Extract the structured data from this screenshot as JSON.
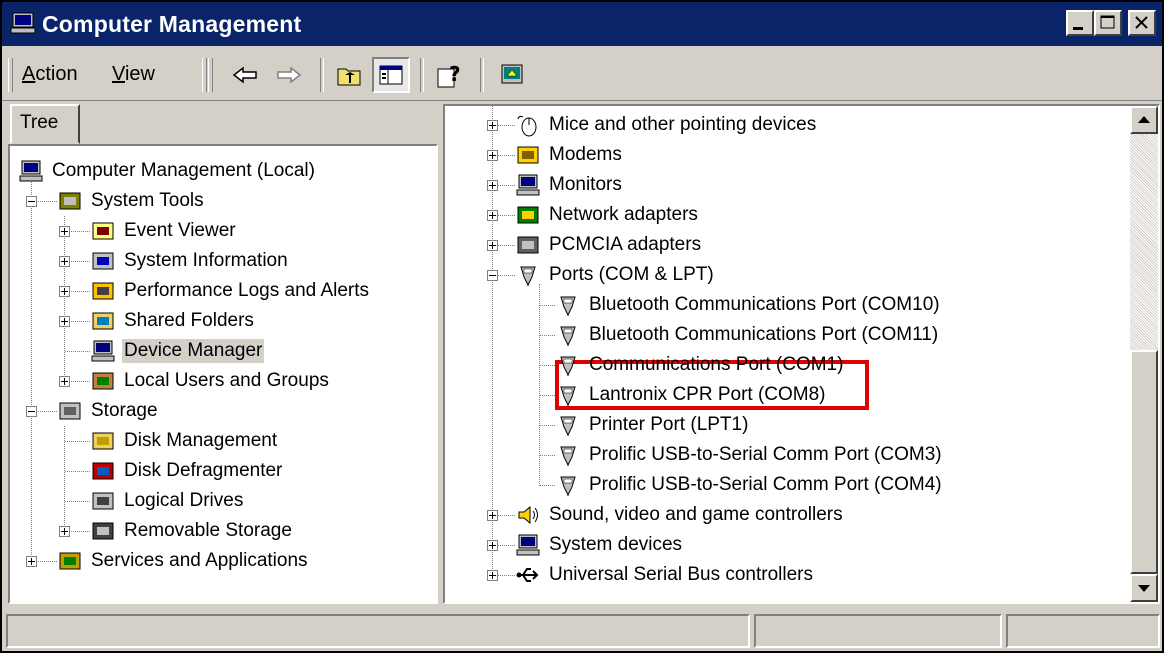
{
  "window": {
    "title": "Computer Management",
    "icon": "computer-management-icon",
    "controls": [
      "minimize",
      "maximize",
      "close"
    ]
  },
  "menubar": {
    "items": [
      {
        "label": "Action",
        "accel": "A"
      },
      {
        "label": "View",
        "accel": "V"
      }
    ],
    "toolbar": [
      "back-arrow-icon",
      "forward-arrow-icon",
      "up-one-level-icon",
      "show-hide-tree-icon",
      "help-icon",
      "device-properties-icon"
    ]
  },
  "left_pane": {
    "tab_label": "Tree",
    "tree": [
      {
        "label": "Computer Management (Local)",
        "icon": "computer-icon",
        "level": 0,
        "expander": "none"
      },
      {
        "label": "System Tools",
        "icon": "system-tools-icon",
        "level": 1,
        "expander": "minus"
      },
      {
        "label": "Event Viewer",
        "icon": "event-viewer-icon",
        "level": 2,
        "expander": "plus"
      },
      {
        "label": "System Information",
        "icon": "system-information-icon",
        "level": 2,
        "expander": "plus"
      },
      {
        "label": "Performance Logs and Alerts",
        "icon": "performance-logs-icon",
        "level": 2,
        "expander": "plus"
      },
      {
        "label": "Shared Folders",
        "icon": "shared-folders-icon",
        "level": 2,
        "expander": "plus"
      },
      {
        "label": "Device Manager",
        "icon": "device-manager-icon",
        "level": 2,
        "expander": "none",
        "selected": true
      },
      {
        "label": "Local Users and Groups",
        "icon": "local-users-icon",
        "level": 2,
        "expander": "plus"
      },
      {
        "label": "Storage",
        "icon": "storage-icon",
        "level": 1,
        "expander": "minus"
      },
      {
        "label": "Disk Management",
        "icon": "disk-management-icon",
        "level": 2,
        "expander": "none"
      },
      {
        "label": "Disk Defragmenter",
        "icon": "disk-defragmenter-icon",
        "level": 2,
        "expander": "none"
      },
      {
        "label": "Logical Drives",
        "icon": "logical-drives-icon",
        "level": 2,
        "expander": "none"
      },
      {
        "label": "Removable Storage",
        "icon": "removable-storage-icon",
        "level": 2,
        "expander": "plus"
      },
      {
        "label": "Services and Applications",
        "icon": "services-applications-icon",
        "level": 1,
        "expander": "plus"
      }
    ]
  },
  "right_pane": {
    "devices": [
      {
        "label": "Mice and other pointing devices",
        "icon": "mouse-icon",
        "level": 0,
        "expander": "plus"
      },
      {
        "label": "Modems",
        "icon": "modem-icon",
        "level": 0,
        "expander": "plus"
      },
      {
        "label": "Monitors",
        "icon": "monitor-icon",
        "level": 0,
        "expander": "plus"
      },
      {
        "label": "Network adapters",
        "icon": "network-adapter-icon",
        "level": 0,
        "expander": "plus"
      },
      {
        "label": "PCMCIA adapters",
        "icon": "pcmcia-icon",
        "level": 0,
        "expander": "plus"
      },
      {
        "label": "Ports (COM & LPT)",
        "icon": "port-icon",
        "level": 0,
        "expander": "minus"
      },
      {
        "label": "Bluetooth Communications Port (COM10)",
        "icon": "port-icon",
        "level": 1,
        "expander": "none"
      },
      {
        "label": "Bluetooth Communications Port (COM11)",
        "icon": "port-icon",
        "level": 1,
        "expander": "none"
      },
      {
        "label": "Communications Port (COM1)",
        "icon": "port-icon",
        "level": 1,
        "expander": "none"
      },
      {
        "label": "Lantronix CPR Port (COM8)",
        "icon": "port-icon",
        "level": 1,
        "expander": "none"
      },
      {
        "label": "Printer Port (LPT1)",
        "icon": "port-icon",
        "level": 1,
        "expander": "none"
      },
      {
        "label": "Prolific USB-to-Serial Comm Port (COM3)",
        "icon": "port-icon",
        "level": 1,
        "expander": "none"
      },
      {
        "label": "Prolific USB-to-Serial Comm Port (COM4)",
        "icon": "port-icon",
        "level": 1,
        "expander": "none"
      },
      {
        "label": "Sound, video and game controllers",
        "icon": "sound-icon",
        "level": 0,
        "expander": "plus"
      },
      {
        "label": "System devices",
        "icon": "system-devices-icon",
        "level": 0,
        "expander": "plus"
      },
      {
        "label": "Universal Serial Bus controllers",
        "icon": "usb-icon",
        "level": 0,
        "expander": "plus"
      }
    ],
    "highlight_color": "#e00000"
  },
  "statusbar": {
    "cells": [
      "",
      "",
      ""
    ]
  }
}
